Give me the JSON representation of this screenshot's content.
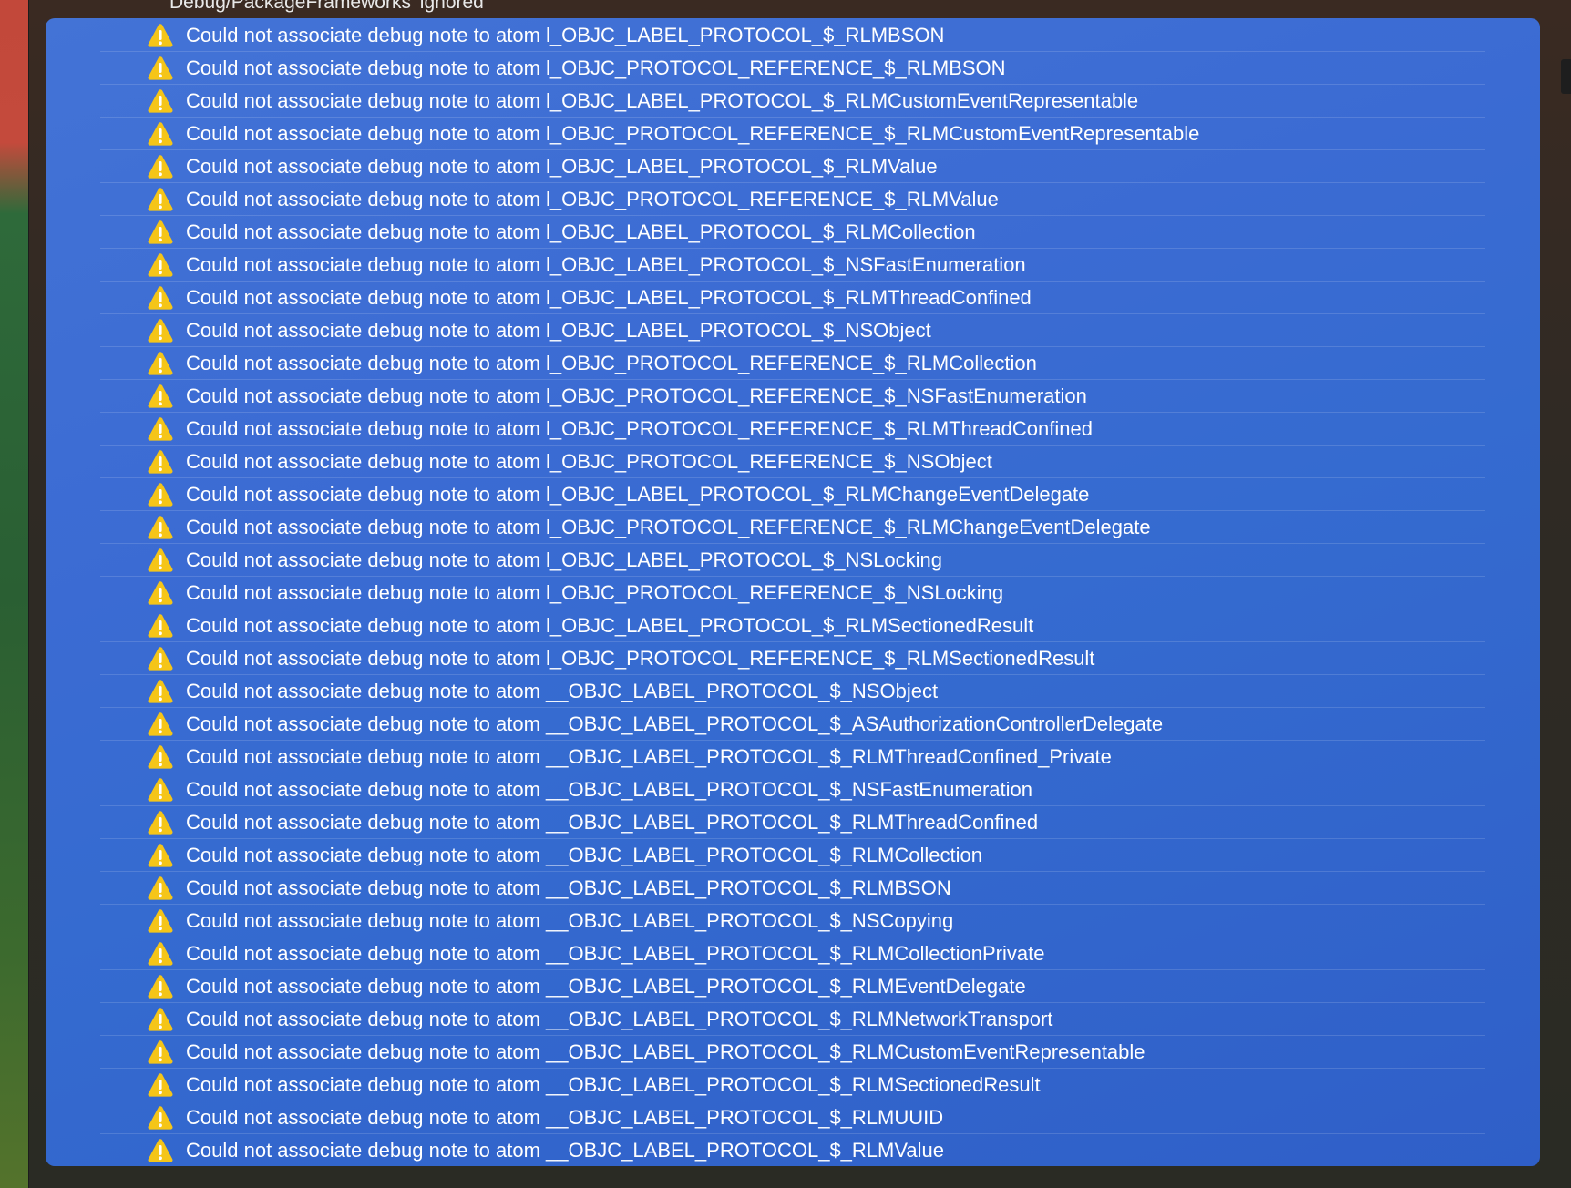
{
  "header": {
    "partial_line": "Debug/PackageFrameworks' ignored"
  },
  "issues": [
    "Could not associate debug note to atom l_OBJC_LABEL_PROTOCOL_$_RLMBSON",
    "Could not associate debug note to atom l_OBJC_PROTOCOL_REFERENCE_$_RLMBSON",
    "Could not associate debug note to atom l_OBJC_LABEL_PROTOCOL_$_RLMCustomEventRepresentable",
    "Could not associate debug note to atom l_OBJC_PROTOCOL_REFERENCE_$_RLMCustomEventRepresentable",
    "Could not associate debug note to atom l_OBJC_LABEL_PROTOCOL_$_RLMValue",
    "Could not associate debug note to atom l_OBJC_PROTOCOL_REFERENCE_$_RLMValue",
    "Could not associate debug note to atom l_OBJC_LABEL_PROTOCOL_$_RLMCollection",
    "Could not associate debug note to atom l_OBJC_LABEL_PROTOCOL_$_NSFastEnumeration",
    "Could not associate debug note to atom l_OBJC_LABEL_PROTOCOL_$_RLMThreadConfined",
    "Could not associate debug note to atom l_OBJC_LABEL_PROTOCOL_$_NSObject",
    "Could not associate debug note to atom l_OBJC_PROTOCOL_REFERENCE_$_RLMCollection",
    "Could not associate debug note to atom l_OBJC_PROTOCOL_REFERENCE_$_NSFastEnumeration",
    "Could not associate debug note to atom l_OBJC_PROTOCOL_REFERENCE_$_RLMThreadConfined",
    "Could not associate debug note to atom l_OBJC_PROTOCOL_REFERENCE_$_NSObject",
    "Could not associate debug note to atom l_OBJC_LABEL_PROTOCOL_$_RLMChangeEventDelegate",
    "Could not associate debug note to atom l_OBJC_PROTOCOL_REFERENCE_$_RLMChangeEventDelegate",
    "Could not associate debug note to atom l_OBJC_LABEL_PROTOCOL_$_NSLocking",
    "Could not associate debug note to atom l_OBJC_PROTOCOL_REFERENCE_$_NSLocking",
    "Could not associate debug note to atom l_OBJC_LABEL_PROTOCOL_$_RLMSectionedResult",
    "Could not associate debug note to atom l_OBJC_PROTOCOL_REFERENCE_$_RLMSectionedResult",
    "Could not associate debug note to atom __OBJC_LABEL_PROTOCOL_$_NSObject",
    "Could not associate debug note to atom __OBJC_LABEL_PROTOCOL_$_ASAuthorizationControllerDelegate",
    "Could not associate debug note to atom __OBJC_LABEL_PROTOCOL_$_RLMThreadConfined_Private",
    "Could not associate debug note to atom __OBJC_LABEL_PROTOCOL_$_NSFastEnumeration",
    "Could not associate debug note to atom __OBJC_LABEL_PROTOCOL_$_RLMThreadConfined",
    "Could not associate debug note to atom __OBJC_LABEL_PROTOCOL_$_RLMCollection",
    "Could not associate debug note to atom __OBJC_LABEL_PROTOCOL_$_RLMBSON",
    "Could not associate debug note to atom __OBJC_LABEL_PROTOCOL_$_NSCopying",
    "Could not associate debug note to atom __OBJC_LABEL_PROTOCOL_$_RLMCollectionPrivate",
    "Could not associate debug note to atom __OBJC_LABEL_PROTOCOL_$_RLMEventDelegate",
    "Could not associate debug note to atom __OBJC_LABEL_PROTOCOL_$_RLMNetworkTransport",
    "Could not associate debug note to atom __OBJC_LABEL_PROTOCOL_$_RLMCustomEventRepresentable",
    "Could not associate debug note to atom __OBJC_LABEL_PROTOCOL_$_RLMSectionedResult",
    "Could not associate debug note to atom __OBJC_LABEL_PROTOCOL_$_RLMUUID",
    "Could not associate debug note to atom __OBJC_LABEL_PROTOCOL_$_RLMValue"
  ],
  "issue_icon": "warning-triangle-icon",
  "colors": {
    "selection": "#3b6bd3",
    "warning": "#f5c518"
  }
}
